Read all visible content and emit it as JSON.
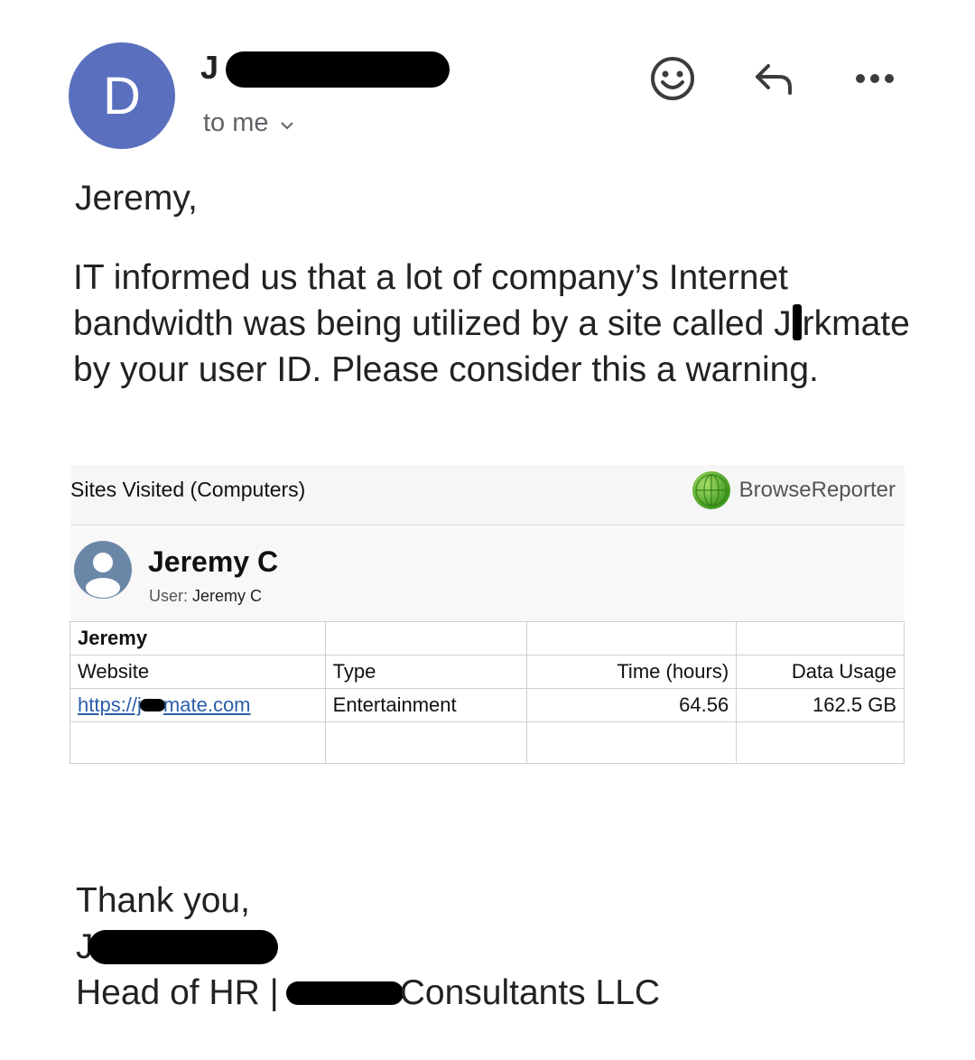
{
  "header": {
    "avatar_letter": "D",
    "sender_initial": "J",
    "recipient_label": "to me"
  },
  "message": {
    "greeting": "Jeremy,",
    "body_before_blot": "IT informed us that a lot of company’s Internet bandwidth was being utilized by a site called J",
    "body_after_blot": "rkmate by your user ID. Please consider this a warning."
  },
  "report": {
    "title": "Sites Visited (Computers)",
    "brand": "BrowseReporter",
    "user_name": "Jeremy C",
    "user_label": "User:",
    "user_value": "Jeremy C",
    "group_label": "Jeremy",
    "columns": [
      "Website",
      "Type",
      "Time (hours)",
      "Data Usage"
    ],
    "row": {
      "website_prefix": "https://j",
      "website_suffix": "mate.com",
      "type": "Entertainment",
      "time_hours": "64.56",
      "data_usage": "162.5 GB"
    }
  },
  "signature": {
    "closing": "Thank you,",
    "name_initial": "J",
    "title_prefix": "Head of HR |",
    "company_suffix": "Consultants LLC"
  },
  "colors": {
    "avatar": "#5b6fbf",
    "link": "#2b5ea8",
    "globe": "#3f9a1e"
  },
  "icons": [
    "emoji-icon",
    "reply-icon",
    "more-icon",
    "chevron-down-icon",
    "globe-icon",
    "user-avatar-icon"
  ]
}
